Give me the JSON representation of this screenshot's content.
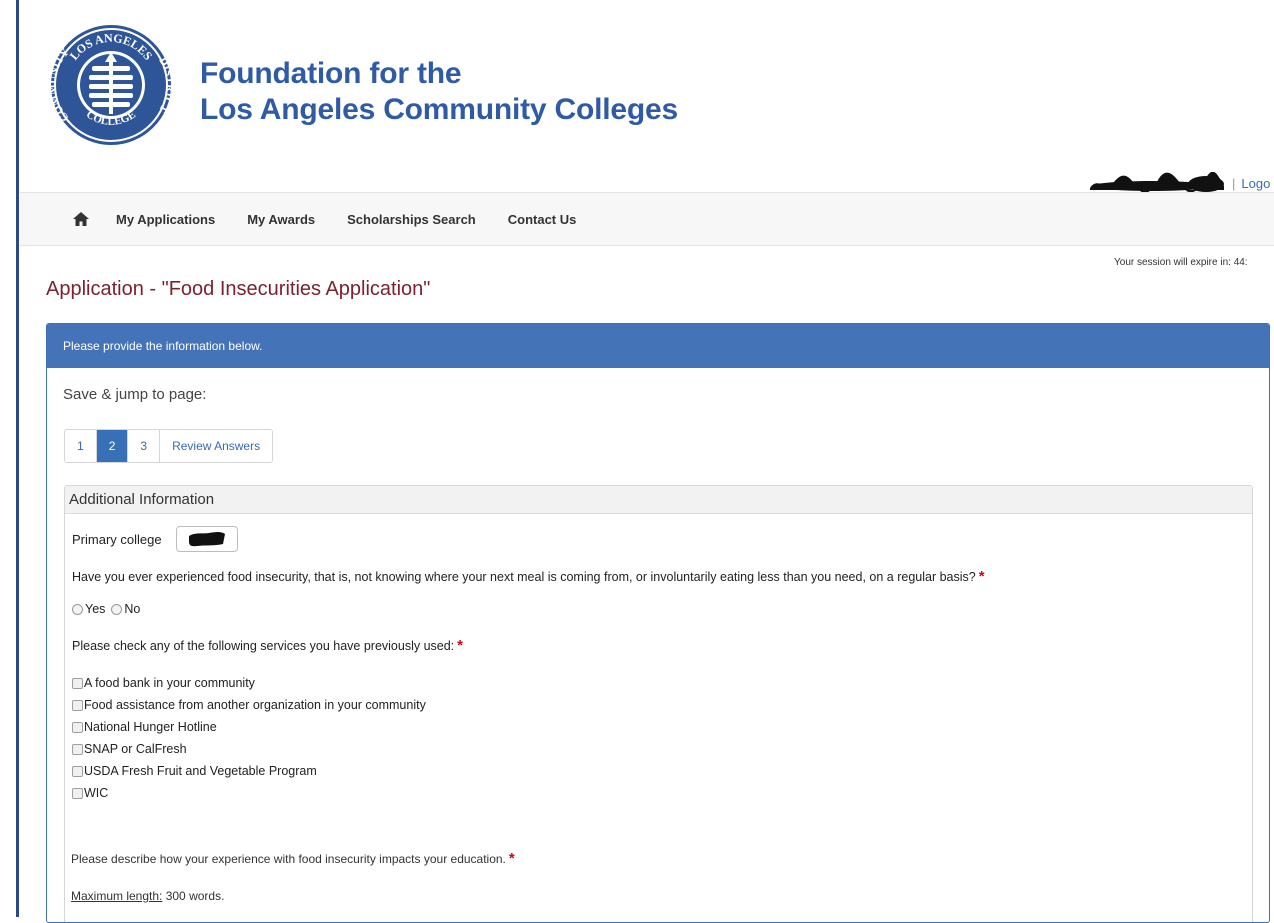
{
  "header": {
    "org_line1": "Foundation for the",
    "org_line2": "Los Angeles Community Colleges",
    "seal_text_top": "LOS ANGELES",
    "seal_text_right": "DISTRICT",
    "seal_text_left": "COMMUNITY",
    "seal_text_bottom": "COLLEGE",
    "separator": "|",
    "logout_label": "Logo"
  },
  "nav": {
    "items": [
      "My Applications",
      "My Awards",
      "Scholarships Search",
      "Contact Us"
    ]
  },
  "session": {
    "text": "Your session will expire in:  44:"
  },
  "page": {
    "title": "Application - \"Food Insecurities Application\""
  },
  "panel": {
    "heading": "Please provide the information below.",
    "jump_label": "Save & jump to page:",
    "pages": [
      "1",
      "2",
      "3",
      "Review Answers"
    ],
    "active_page": "2"
  },
  "section": {
    "title": "Additional Information",
    "college_label": "Primary college",
    "q1": "Have you ever experienced food insecurity, that is, not knowing where your next meal is coming from, or involuntarily eating less than you need, on a regular basis?",
    "required_mark": "*",
    "yes_label": "Yes",
    "no_label": "No",
    "q2": "Please check any of the following services you have previously used:",
    "services": [
      "A food bank in your community",
      "Food assistance from another organization in your community",
      "National Hunger Hotline",
      "SNAP or CalFresh",
      "USDA Fresh Fruit and Vegetable Program",
      "WIC"
    ],
    "q3": "Please describe how your experience with food insecurity impacts your education.",
    "maxlen_label": "Maximum length:",
    "maxlen_value": " 300 words."
  },
  "colors": {
    "brand_blue": "#2f5aa6",
    "panel_header": "#4473b8",
    "title_maroon": "#7b2230",
    "required_red": "#d0021b"
  }
}
